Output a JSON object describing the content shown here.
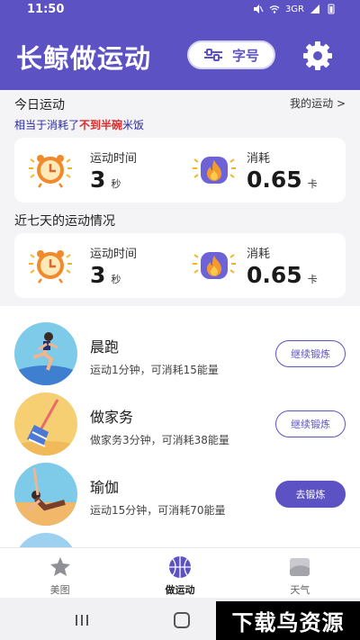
{
  "status_bar": {
    "time": "11:50",
    "network": "3GR",
    "icons": [
      "mute-icon",
      "wifi-icon",
      "signal-icon",
      "battery-icon"
    ]
  },
  "header": {
    "title": "长鲸做运动",
    "font_button_label": "字号",
    "settings_icon": "gear-icon"
  },
  "today": {
    "title": "今日运动",
    "my_sport_link": "我的运动 >",
    "equiv_prefix": "相当于消耗了",
    "equiv_highlight": "不到半碗",
    "equiv_suffix": "米饭",
    "duration_label": "运动时间",
    "duration_value": "3",
    "duration_unit": "秒",
    "calorie_label": "消耗",
    "calorie_value": "0.65",
    "calorie_unit": "卡"
  },
  "week": {
    "title": "近七天的运动情况",
    "duration_label": "运动时间",
    "duration_value": "3",
    "duration_unit": "秒",
    "calorie_label": "消耗",
    "calorie_value": "0.65",
    "calorie_unit": "卡"
  },
  "activities": [
    {
      "name": "晨跑",
      "desc": "运动1分钟，可消耗15能量",
      "button": "继续锻炼",
      "primary": false
    },
    {
      "name": "做家务",
      "desc": "做家务3分钟，可消耗38能量",
      "button": "继续锻炼",
      "primary": false
    },
    {
      "name": "瑜伽",
      "desc": "运动15分钟，可消耗70能量",
      "button": "去锻炼",
      "primary": true
    }
  ],
  "tabs": [
    {
      "label": "美图",
      "icon": "star-image-icon",
      "active": false
    },
    {
      "label": "做运动",
      "icon": "basketball-icon",
      "active": true
    },
    {
      "label": "天气",
      "icon": "weather-icon",
      "active": false
    }
  ],
  "watermark": "下载鸟资源",
  "colors": {
    "brand": "#5c52c4",
    "highlight": "#e02b2b",
    "background": "#f4f4f7"
  }
}
